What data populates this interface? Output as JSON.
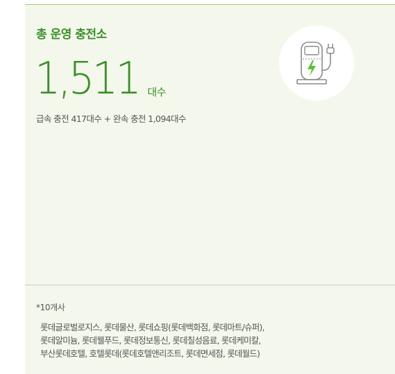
{
  "card": {
    "title": "총 운영 충전소",
    "total_number": "1,511",
    "total_unit": "대수",
    "detail": "급속 충전 417대수 + 완속 충전 1,094대수",
    "icon": "ev-charger-icon",
    "accent_color": "#3b8f2a"
  },
  "note": {
    "title": "*10개사",
    "lines": [
      "롯데글로벌로지스, 롯데물산, 롯데쇼핑(롯데백화점, 롯데마트/슈퍼),",
      "롯데알미늄, 롯데웰푸드, 롯데정보통신, 롯데칠성음료, 롯데케미칼,",
      "부산롯데호텔, 호텔롯데(롯데호텔앤리조트, 롯데면세점, 롯데월드)"
    ]
  }
}
